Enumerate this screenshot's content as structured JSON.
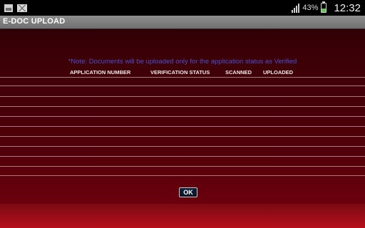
{
  "status_bar": {
    "battery_percent": "43%",
    "battery_level": 0.43,
    "time": "12:32",
    "icons": [
      "picture-icon",
      "gmail-icon",
      "signal-icon",
      "battery-icon"
    ]
  },
  "title_bar": {
    "title": "E-DOC UPLOAD"
  },
  "content": {
    "note": "*Note: Documents will be uploaded only for the application status as Verified",
    "table": {
      "columns": [
        "APPLICATION NUMBER",
        "VERIFICATION STATUS",
        "SCANNED",
        "UPLOADED"
      ],
      "rows": []
    },
    "ok_label": "OK"
  },
  "colors": {
    "panel_dark": "#3a0007",
    "panel_red": "#b50f1b",
    "note_text": "#4a4fd0",
    "title_bar": "#7f7f7f"
  }
}
